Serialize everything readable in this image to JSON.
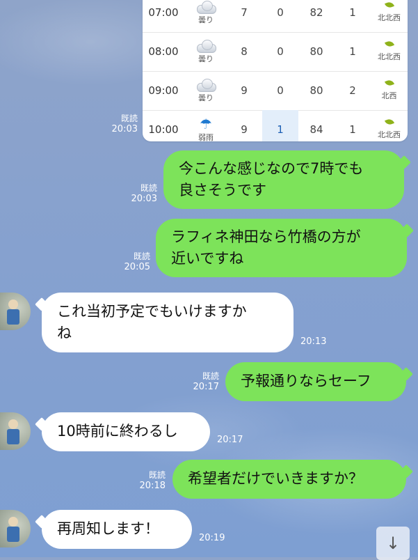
{
  "weather": {
    "rows": [
      {
        "time": "07:00",
        "condition": "曇り",
        "temp": "7",
        "rain": "0",
        "humidity": "82",
        "wind": "1",
        "direction": "北北西",
        "icon": "cloud-icon"
      },
      {
        "time": "08:00",
        "condition": "曇り",
        "temp": "8",
        "rain": "0",
        "humidity": "80",
        "wind": "1",
        "direction": "北北西",
        "icon": "cloud-icon"
      },
      {
        "time": "09:00",
        "condition": "曇り",
        "temp": "9",
        "rain": "0",
        "humidity": "80",
        "wind": "2",
        "direction": "北西",
        "icon": "cloud-icon"
      },
      {
        "time": "10:00",
        "condition": "弱雨",
        "temp": "9",
        "rain": "1",
        "humidity": "84",
        "wind": "1",
        "direction": "北北西",
        "icon": "umbrella-icon"
      }
    ]
  },
  "messages": [
    {
      "type": "out",
      "read": "既読",
      "time": "20:03",
      "lines": [
        "今こんな感じなので7時でも",
        "良さそうです"
      ]
    },
    {
      "type": "out",
      "read": "既読",
      "time": "20:05",
      "lines": [
        "ラフィネ神田なら竹橋の方が",
        "近いですね"
      ]
    },
    {
      "type": "in",
      "time": "20:13",
      "lines": [
        "これ当初予定でもいけますか",
        "ね"
      ]
    },
    {
      "type": "out",
      "read": "既読",
      "time": "20:17",
      "lines": [
        "予報通りならセーフ"
      ]
    },
    {
      "type": "in",
      "time": "20:17",
      "lines": [
        "10時前に終わるし"
      ]
    },
    {
      "type": "out",
      "read": "既読",
      "time": "20:18",
      "lines": [
        "希望者だけでいきますか？"
      ]
    },
    {
      "type": "in",
      "time": "20:19",
      "lines": [
        "再周知します！"
      ]
    }
  ],
  "image_receipt": {
    "read": "既読",
    "time": "20:03"
  },
  "scroll_down_icon": "arrow-down-icon"
}
